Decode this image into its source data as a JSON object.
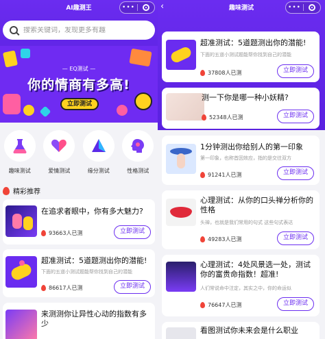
{
  "left": {
    "title": "AI趣测王",
    "search_placeholder": "搜索关键词，发现更多有趣",
    "banner": {
      "subtitle": "— EQ测试 —",
      "headline": "你的情商有多高!",
      "cta": "立即测试"
    },
    "categories": [
      {
        "label": "趣味测试",
        "icon": "flask-icon"
      },
      {
        "label": "爱情测试",
        "icon": "heart-icon"
      },
      {
        "label": "缘分测试",
        "icon": "triangle-icon"
      },
      {
        "label": "性格测试",
        "icon": "head-icon"
      }
    ],
    "section_title": "精彩推荐",
    "cards": [
      {
        "title": "在追求者眼中，你有多大魅力?",
        "count": "93663人已测",
        "button": "立即测试"
      },
      {
        "title": "超准测试：5道题测出你的潜能!",
        "desc": "下面的五道小测试题能帮你找到自己的潜能",
        "count": "86617人已测",
        "button": "立即测试"
      },
      {
        "title": "来测测你让异性心动的指数有多少"
      }
    ]
  },
  "right": {
    "title": "趣味测试",
    "cards": [
      {
        "title": "超准测试：5道题测出你的潜能!",
        "desc": "下面的五道小测试题能帮你找到自己的潜能",
        "count": "37808人已测",
        "button": "立即测试"
      },
      {
        "title": "测一下你是哪一种小妖精?",
        "count": "52348人已测",
        "button": "立即测试"
      },
      {
        "title": "1分钟测出你给别人的第一印象",
        "desc": "第一印象，也称首因效应，指的是交往双方",
        "count": "91241人已测",
        "button": "立即测试"
      },
      {
        "title": "心理测试：从你的口头禅分析你的性格",
        "desc": "头禅，也就是我们常用的句式 这些句式表达",
        "count": "49283人已测",
        "button": "立即测试"
      },
      {
        "title": "心理测试：4处风景选一处，测试你的富贵命指数！超准!",
        "desc": "人们常说命中注定，其实之中，你的命运似",
        "count": "76647人已测",
        "button": "立即测试"
      },
      {
        "title": "看图测试你未来会是什么职业"
      }
    ]
  },
  "colors": {
    "brand_purple": "#6a2cf0",
    "banner_yellow": "#ffd21f",
    "flame_red": "#f04438"
  }
}
